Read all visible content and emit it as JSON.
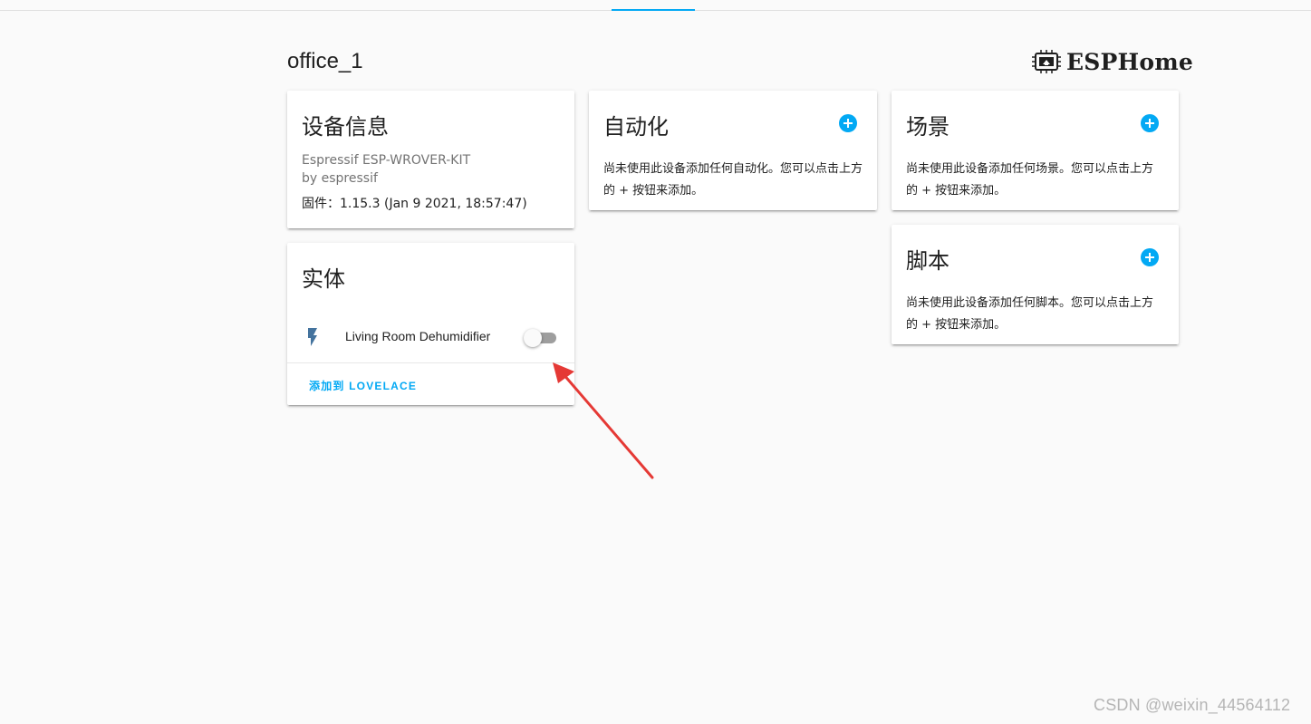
{
  "page": {
    "device_name": "office_1",
    "logo_text": "ESPHome",
    "watermark": "CSDN @weixin_44564112"
  },
  "colors": {
    "accent": "#03a9f4",
    "arrow": "#e53935",
    "toggle_track": "#9e9e9e"
  },
  "device_info": {
    "title": "设备信息",
    "model": "Espressif ESP-WROVER-KIT",
    "manufacturer": "by espressif",
    "firmware": "固件：1.15.3 (Jan 9 2021, 18:57:47)"
  },
  "entities": {
    "title": "实体",
    "items": [
      {
        "name": "Living Room Dehumidifier",
        "icon": "flash-icon",
        "state": "off"
      }
    ],
    "add_lovelace": "添加到 LOVELACE"
  },
  "automation": {
    "title": "自动化",
    "text": "尚未使用此设备添加任何自动化。您可以点击上方的 + 按钮来添加。",
    "add_icon": "plus-circle-icon"
  },
  "scene": {
    "title": "场景",
    "text": "尚未使用此设备添加任何场景。您可以点击上方的 + 按钮来添加。",
    "add_icon": "plus-circle-icon"
  },
  "script": {
    "title": "脚本",
    "text": "尚未使用此设备添加任何脚本。您可以点击上方的 + 按钮来添加。",
    "add_icon": "plus-circle-icon"
  }
}
